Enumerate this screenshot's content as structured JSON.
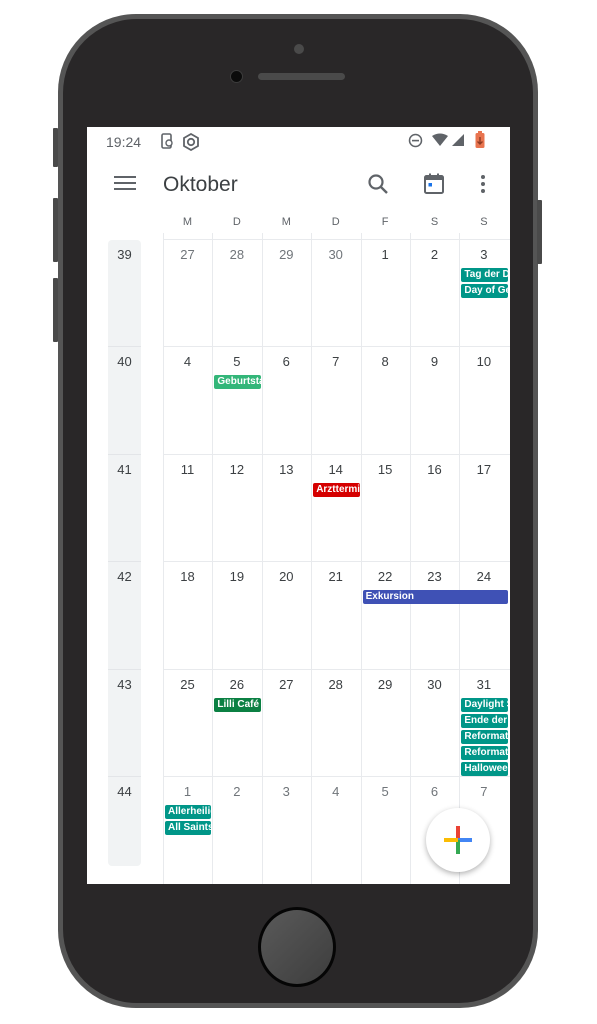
{
  "status_bar": {
    "time": "19:24",
    "left_icons": [
      "phone-sync-icon",
      "hexagon-settings-icon"
    ],
    "right_icons": [
      "do-not-disturb-icon",
      "wifi-icon",
      "signal-icon",
      "battery-icon"
    ]
  },
  "header": {
    "title": "Oktober",
    "icons": [
      "menu-icon",
      "search-icon",
      "today-icon",
      "more-icon"
    ]
  },
  "weekdays": [
    "M",
    "D",
    "M",
    "D",
    "F",
    "S",
    "S"
  ],
  "weeks": [
    {
      "number": "39",
      "days": [
        "27",
        "28",
        "29",
        "30",
        "1",
        "2",
        "3"
      ],
      "other_month": [
        true,
        true,
        true,
        true,
        false,
        false,
        false
      ]
    },
    {
      "number": "40",
      "days": [
        "4",
        "5",
        "6",
        "7",
        "8",
        "9",
        "10"
      ],
      "other_month": [
        false,
        false,
        false,
        false,
        false,
        false,
        false
      ]
    },
    {
      "number": "41",
      "days": [
        "11",
        "12",
        "13",
        "14",
        "15",
        "16",
        "17"
      ],
      "other_month": [
        false,
        false,
        false,
        false,
        false,
        false,
        false
      ]
    },
    {
      "number": "42",
      "days": [
        "18",
        "19",
        "20",
        "21",
        "22",
        "23",
        "24"
      ],
      "other_month": [
        false,
        false,
        false,
        false,
        false,
        false,
        false
      ]
    },
    {
      "number": "43",
      "days": [
        "25",
        "26",
        "27",
        "28",
        "29",
        "30",
        "31"
      ],
      "other_month": [
        false,
        false,
        false,
        false,
        false,
        false,
        false
      ]
    },
    {
      "number": "44",
      "days": [
        "1",
        "2",
        "3",
        "4",
        "5",
        "6",
        "7"
      ],
      "other_month": [
        true,
        true,
        true,
        true,
        true,
        true,
        true
      ]
    }
  ],
  "events": [
    {
      "label": "Tag der Deutschen Einheit",
      "week": 0,
      "day": 6,
      "span": 1,
      "slot": 0,
      "color": "#009688"
    },
    {
      "label": "Day of German Unity",
      "week": 0,
      "day": 6,
      "span": 1,
      "slot": 1,
      "color": "#009688"
    },
    {
      "label": "Geburtstag",
      "week": 1,
      "day": 1,
      "span": 1,
      "slot": 0,
      "color": "#33b679"
    },
    {
      "label": "Arzttermin",
      "week": 2,
      "day": 3,
      "span": 1,
      "slot": 0,
      "color": "#d50000"
    },
    {
      "label": "Exkursion",
      "week": 3,
      "day": 4,
      "span": 3,
      "slot": 0,
      "color": "#3f51b5"
    },
    {
      "label": "Lilli Café",
      "week": 4,
      "day": 1,
      "span": 1,
      "slot": 0,
      "color": "#0b8043"
    },
    {
      "label": "Daylight Saving Time ends",
      "week": 4,
      "day": 6,
      "span": 1,
      "slot": 0,
      "color": "#009688"
    },
    {
      "label": "Ende der Sommerzeit",
      "week": 4,
      "day": 6,
      "span": 1,
      "slot": 1,
      "color": "#009688"
    },
    {
      "label": "Reformationstag",
      "week": 4,
      "day": 6,
      "span": 1,
      "slot": 2,
      "color": "#009688"
    },
    {
      "label": "Reformation Day",
      "week": 4,
      "day": 6,
      "span": 1,
      "slot": 3,
      "color": "#009688"
    },
    {
      "label": "Halloween",
      "week": 4,
      "day": 6,
      "span": 1,
      "slot": 4,
      "color": "#009688"
    },
    {
      "label": "Allerheiligen",
      "week": 5,
      "day": 0,
      "span": 1,
      "slot": 0,
      "color": "#009688"
    },
    {
      "label": "All Saints' Day",
      "week": 5,
      "day": 0,
      "span": 1,
      "slot": 1,
      "color": "#009688"
    }
  ],
  "fab": {
    "label": "create-event",
    "icon": "plus-icon"
  },
  "colors": {
    "battery": "#e8744f",
    "fab_red": "#ea4335",
    "fab_blue": "#4285f4",
    "fab_green": "#34a853",
    "fab_yellow": "#fbbc04",
    "today_dot": "#1a73e8"
  }
}
